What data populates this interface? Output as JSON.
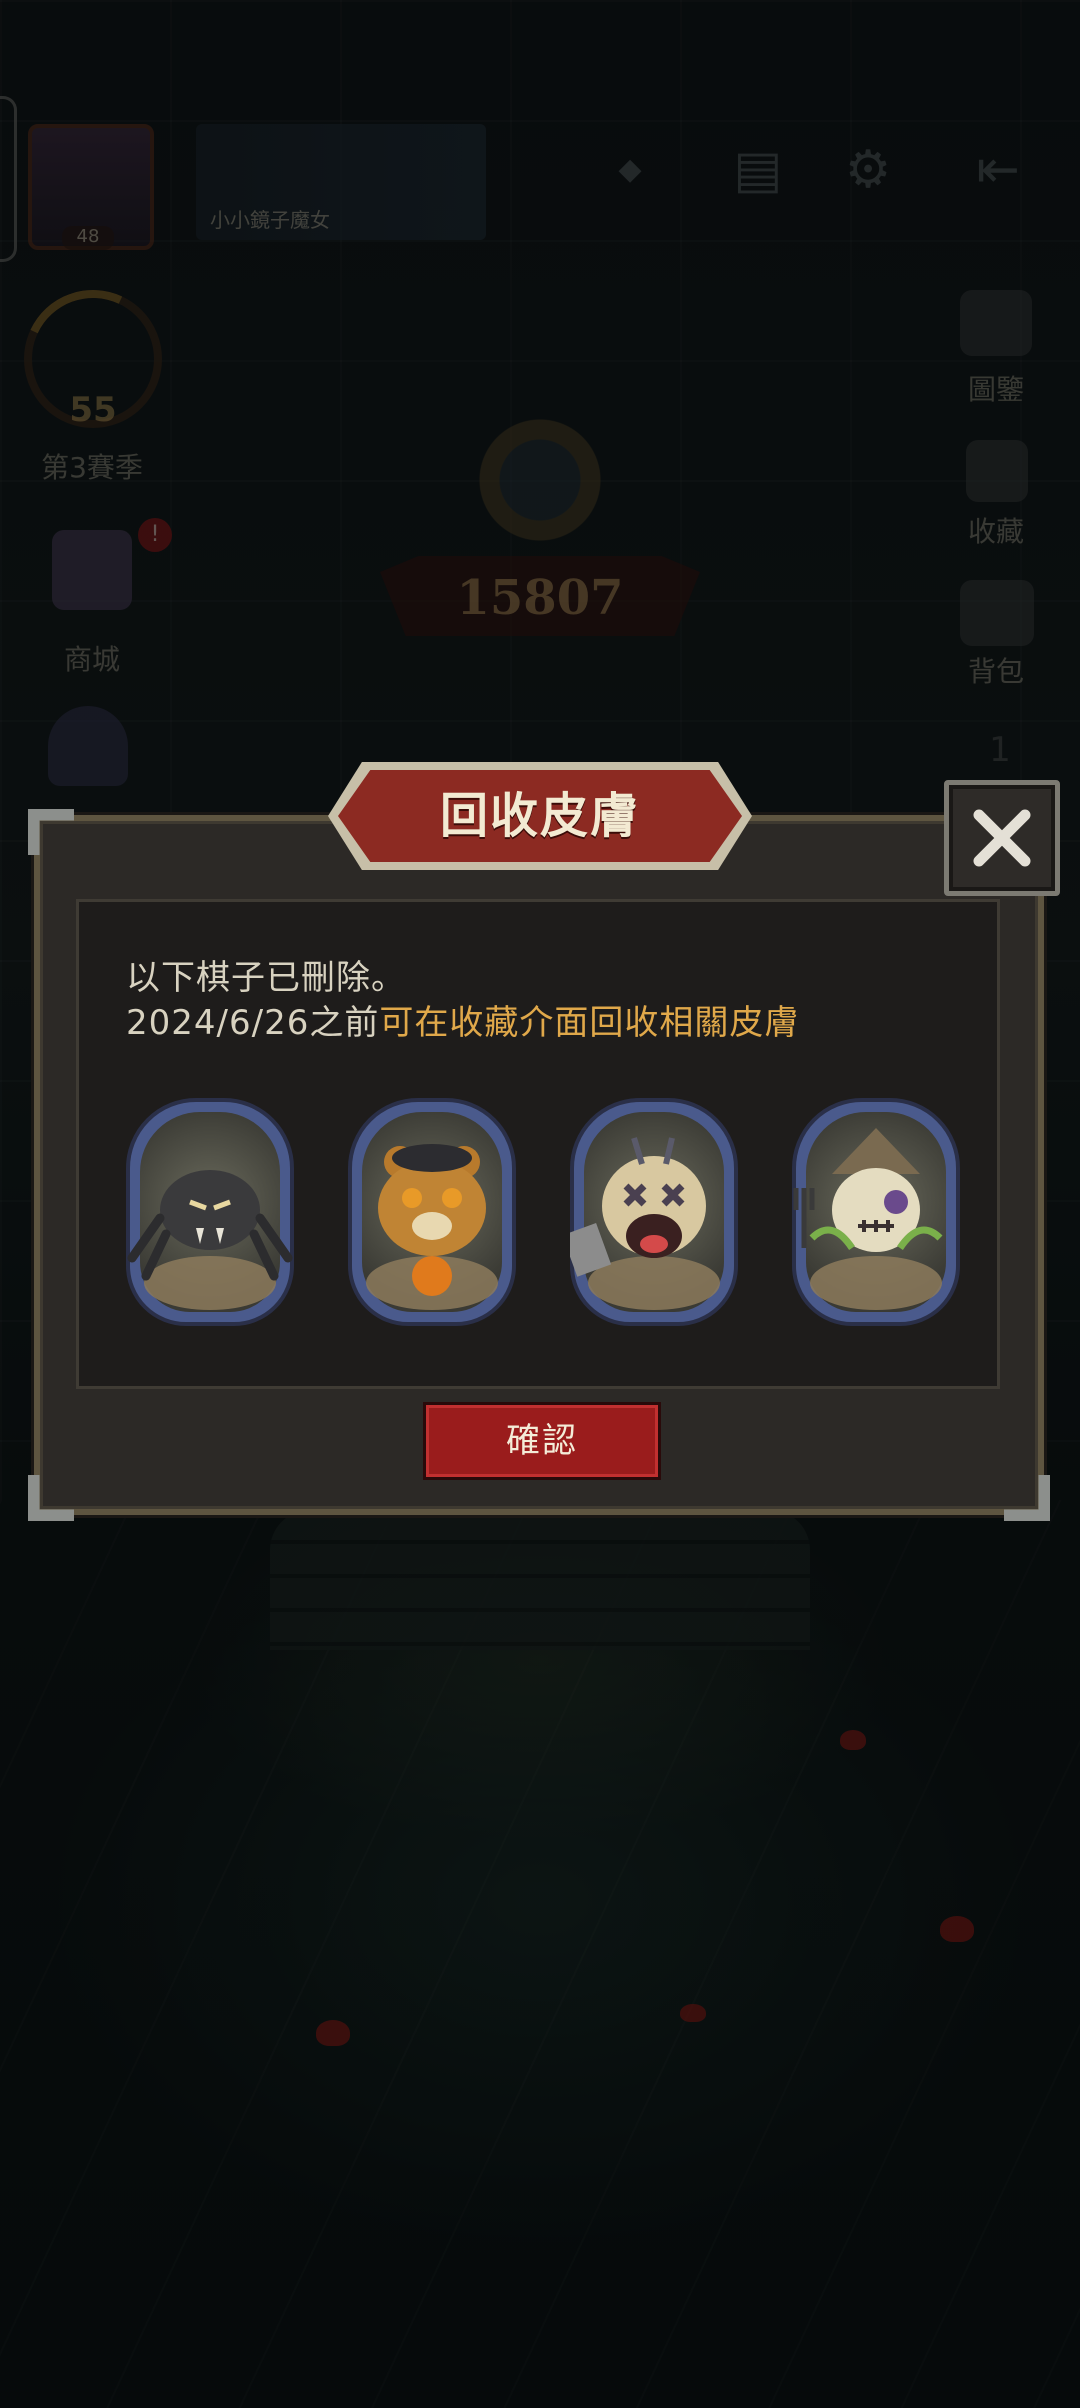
{
  "player": {
    "avatar_level": "48",
    "name": "小小鏡子魔女"
  },
  "season": {
    "level": "55",
    "label": "第3賽季"
  },
  "left_menu": {
    "shop_label": "商城",
    "shop_badge": "!"
  },
  "right_menu": {
    "codex_label": "圖鑒",
    "collection_label": "收藏",
    "backpack_label": "背包",
    "extra_badge": "1"
  },
  "rank": {
    "score": "15807"
  },
  "dialog": {
    "title": "回收皮膚",
    "line1": "以下棋子已刪除。",
    "line2_date": "2024/6/26之前",
    "line2_highlight": "可在收藏介面回收相關皮膚",
    "confirm_label": "確認",
    "pieces": [
      {
        "name": "spider-piece-icon"
      },
      {
        "name": "bear-piece-icon"
      },
      {
        "name": "voodoo-doll-piece-icon"
      },
      {
        "name": "scarecrow-piece-icon"
      }
    ]
  },
  "colors": {
    "title_red": "#8c2a22",
    "confirm_red": "#9a1c1c",
    "highlight": "#e0a84a",
    "frame_blue": "#4a5a8c"
  }
}
